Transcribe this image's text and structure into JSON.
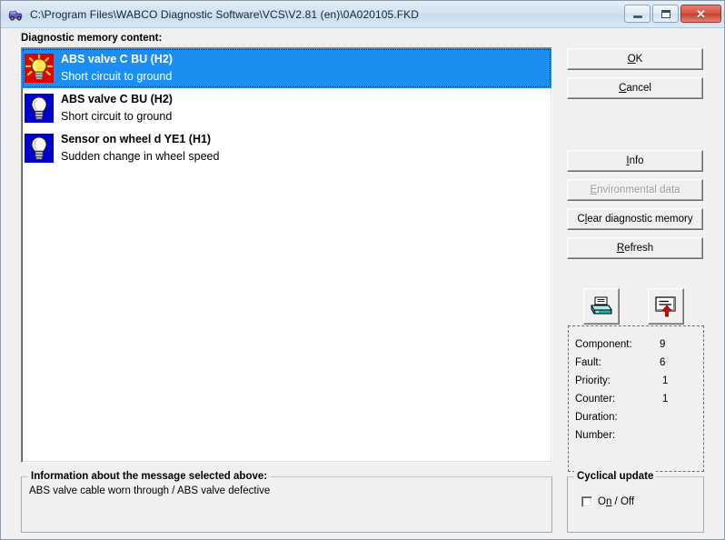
{
  "window": {
    "title": "C:\\Program Files\\WABCO Diagnostic Software\\VCS\\V2.81 (en)\\0A020105.FKD",
    "app_icon": "truck-icon",
    "controls": {
      "minimize": "minimize-icon",
      "maximize": "maximize-icon",
      "close": "✕"
    }
  },
  "list": {
    "label": "Diagnostic memory content:",
    "items": [
      {
        "title": "ABS valve C BU (H2)",
        "subtitle": "Short circuit to ground",
        "icon": "lamp-active-icon",
        "selected": true
      },
      {
        "title": "ABS valve C BU (H2)",
        "subtitle": "Short circuit to ground",
        "icon": "lamp-inactive-icon",
        "selected": false
      },
      {
        "title": "Sensor on wheel d YE1 (H1)",
        "subtitle": "Sudden change in wheel speed",
        "icon": "lamp-inactive-icon",
        "selected": false
      }
    ]
  },
  "buttons": {
    "ok": {
      "pre": "O",
      "accel": "K",
      "post": "",
      "label": "OK",
      "enabled": true
    },
    "cancel": {
      "pre": "",
      "accel": "C",
      "post": "ancel",
      "label": "Cancel",
      "enabled": true
    },
    "info": {
      "pre": "",
      "accel": "I",
      "post": "nfo",
      "label": "Info",
      "enabled": true
    },
    "environmental_data": {
      "pre": "",
      "accel": "E",
      "post": "nvironmental data",
      "label": "Environmental data",
      "enabled": false
    },
    "clear_memory": {
      "pre": "C",
      "accel": "l",
      "post": "ear diagnostic memory",
      "label": "Clear diagnostic memory",
      "enabled": true
    },
    "refresh": {
      "pre": "",
      "accel": "R",
      "post": "efresh",
      "label": "Refresh",
      "enabled": true
    }
  },
  "toolbar": {
    "print": "printer-icon",
    "export": "save-export-icon"
  },
  "details": {
    "rows": [
      {
        "label": "Component:",
        "value": "9"
      },
      {
        "label": "Fault:",
        "value": "6"
      },
      {
        "label": "Priority:",
        "value": "1"
      },
      {
        "label": "Counter:",
        "value": "1"
      },
      {
        "label": "Duration:",
        "value": ""
      },
      {
        "label": "Number:",
        "value": ""
      }
    ]
  },
  "message_info": {
    "legend": "Information about the message selected above:",
    "text": "ABS valve cable worn through / ABS valve defective"
  },
  "cyclical_update": {
    "legend": "Cyclical update",
    "checkbox": {
      "pre": "O",
      "accel": "n",
      "post": " / Off",
      "label": "On / Off",
      "checked": false
    }
  },
  "colors": {
    "dialog_bg": "#f0f0f0",
    "selection": "#1c8ef2",
    "icon_active_bg": "#e00000",
    "icon_inactive_bg": "#0000cc",
    "title_gradient_top": "#e4eef7",
    "close_button": "#c33f2c"
  }
}
